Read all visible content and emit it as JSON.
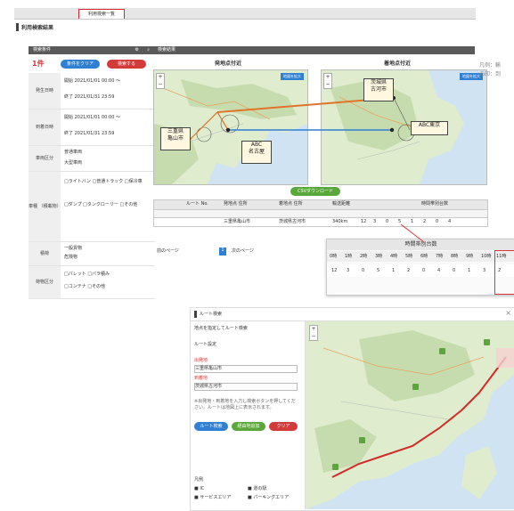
{
  "top": {
    "tabs": [
      "",
      "",
      "利用検索一覧"
    ],
    "page_title": "利用検索結果",
    "left_panel": {
      "header": "検索条件",
      "count": "1件",
      "btn_blue": "条件をクリア",
      "btn_red": "検索する",
      "rows": [
        {
          "label": "発生日時",
          "v1": "開始  2021/01/01 00:00  〜",
          "v2": "終了  2021/01/31 23:59"
        },
        {
          "label": "到着日時",
          "v1": "開始  2021/01/01 00:00  〜",
          "v2": "終了  2021/01/31 23:59"
        },
        {
          "label": "車両区分",
          "v1": "普通車両",
          "v2": "大型車両"
        },
        {
          "label": "車種\n（積載物）",
          "v1": "□ライトバン  □普通トラック  □保冷車",
          "v2": "□ダンプ  □タンクローリー  □その他"
        },
        {
          "label": "積荷",
          "v1": "一般貨物",
          "v2": "危険物"
        },
        {
          "label": "荷物区分",
          "v1": "□パレット  □バラ積み",
          "v2": "□コンテナ  □その他"
        }
      ]
    },
    "right_panel": {
      "header": "検索結果",
      "map_left_title": "発地点付近",
      "map_right_title": "着地点付近",
      "map_badge": "地図を拡大",
      "callout_left": "三重県\n亀山市",
      "callout_mid": "ABC\n名古屋",
      "callout_right_top": "茨城県\n古河市",
      "callout_right": "ABC東京",
      "side_text_1": "凡例：輸",
      "side_text_2": "凸印：到",
      "csv_button": "CSVダウンロード",
      "table_head_1": [
        "",
        "ルート No.",
        "発地点 住所",
        "着地点 住所",
        "輸送距離",
        "時間帯別台数"
      ],
      "table_row": [
        "",
        "",
        "三重県亀山市",
        "茨城県古河市",
        "340km",
        "12",
        "3",
        "0",
        "5",
        "1",
        "2",
        "0",
        "4"
      ],
      "pager": [
        "前のページ",
        "1",
        "次のページ"
      ],
      "zoom_header": "時間帯別台数",
      "zoom_hours": [
        "0時",
        "1時",
        "2時",
        "3時",
        "4時",
        "5時",
        "6時",
        "7時",
        "8時",
        "9時",
        "10時",
        "11時"
      ],
      "zoom_values": [
        "12",
        "3",
        "0",
        "5",
        "1",
        "2",
        "0",
        "4",
        "0",
        "1",
        "3",
        "2"
      ]
    }
  },
  "bottom": {
    "title": "ルート検索",
    "section1": "地点を指定してルート検索",
    "label_route": "ルート設定",
    "label_start": "出発地",
    "label_goal": "到着地",
    "start_value": "三重県亀山市",
    "goal_value": "茨城県古河市",
    "note": "※出発地・到着地を入力し検索ボタンを押してください。ルートは地図上に表示されます。",
    "btn_blue": "ルート検索",
    "btn_green": "経由地追加",
    "btn_red": "クリア",
    "legend_title": "凡例",
    "legend_items": [
      "IC",
      "道の駅",
      "サービスエリア",
      "パーキングエリア"
    ]
  },
  "colors": {
    "accent_blue": "#2f7fd3",
    "accent_red": "#d33b3b",
    "accent_green": "#59a839",
    "route_red": "#d42a2a"
  }
}
